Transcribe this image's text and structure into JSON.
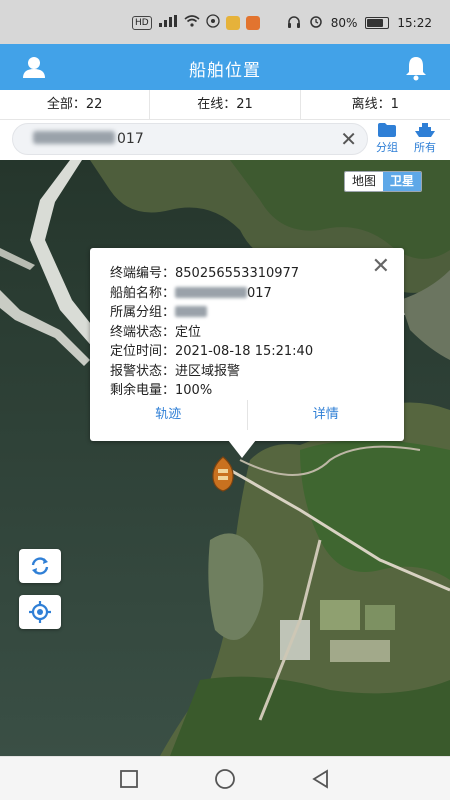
{
  "status_bar": {
    "chip_hd": "HD",
    "chip_signal": "⁴⁶",
    "battery_percent": "80%",
    "battery_level": 0.8,
    "time": "15:22"
  },
  "header": {
    "title": "船舶位置"
  },
  "stats": {
    "all": "全部：22",
    "online": "在线：21",
    "offline": "离线：1"
  },
  "search": {
    "value_suffix": "017",
    "clear_icon": "close-icon"
  },
  "tools": {
    "group_label": "分组",
    "all_label": "所有"
  },
  "map_toggle": {
    "map_label": "地图",
    "satellite_label": "卫星",
    "active": "satellite"
  },
  "popup": {
    "close_label": "✕",
    "terminal_id_label": "终端编号：",
    "terminal_id": "850256553310977",
    "ship_name_label": "船舶名称：",
    "ship_name_suffix": "017",
    "group_label": "所属分组：",
    "terminal_status_label": "终端状态：",
    "terminal_status": "定位",
    "location_time_label": "定位时间：",
    "location_time": "2021-08-18 15:21:40",
    "alarm_status_label": "报警状态：",
    "alarm_status": "进区域报警",
    "battery_label": "剩余电量：",
    "battery": "100%",
    "track_link": "轨迹",
    "details_link": "详情"
  },
  "colors": {
    "header_bg": "#42a2e8",
    "accent_link": "#2f7fd6",
    "toggle_active": "#5ea8e8"
  }
}
